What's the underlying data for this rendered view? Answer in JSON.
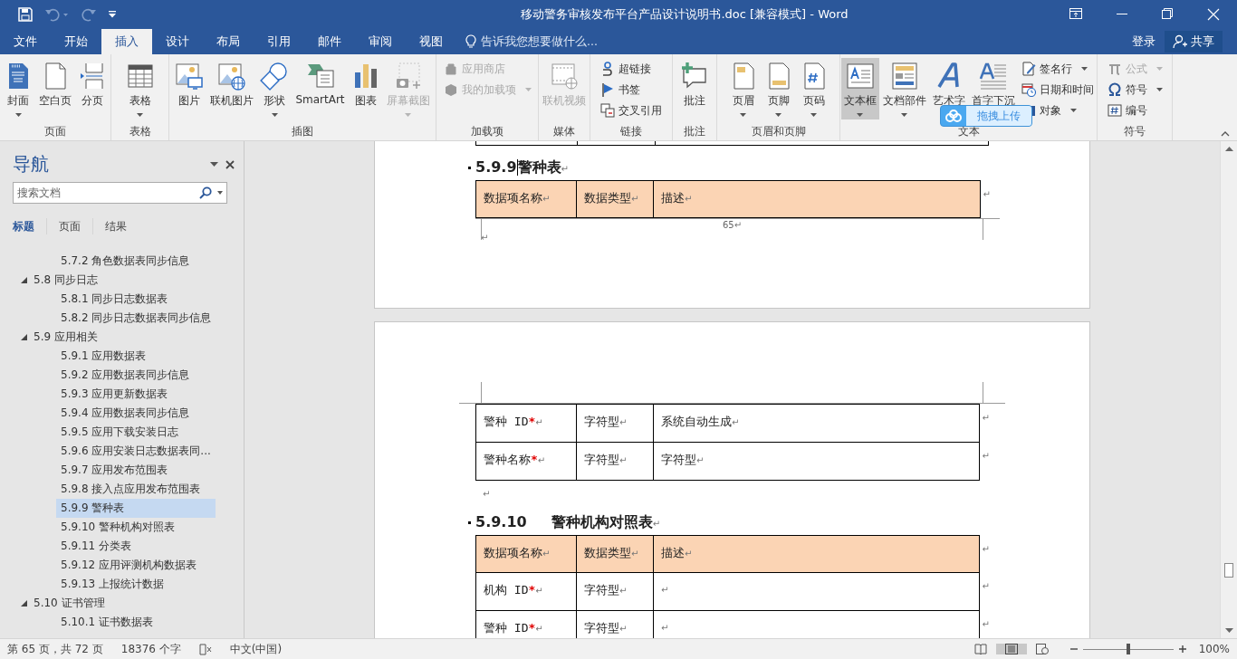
{
  "window": {
    "title": "移动警务审核发布平台产品设计说明书.doc [兼容模式] - Word"
  },
  "ribbon_tabs": [
    {
      "label": "文件",
      "selected": false
    },
    {
      "label": "开始",
      "selected": false
    },
    {
      "label": "插入",
      "selected": true
    },
    {
      "label": "设计",
      "selected": false
    },
    {
      "label": "布局",
      "selected": false
    },
    {
      "label": "引用",
      "selected": false
    },
    {
      "label": "邮件",
      "selected": false
    },
    {
      "label": "审阅",
      "selected": false
    },
    {
      "label": "视图",
      "selected": false
    }
  ],
  "tell_me": {
    "placeholder": "告诉我您想要做什么..."
  },
  "account": {
    "sign_in": "登录",
    "share": "共享"
  },
  "ribbon_groups": [
    {
      "label": "页面",
      "items": [
        {
          "kind": "large",
          "label": "封面",
          "dropdown": true,
          "disabled": false,
          "pressed": false
        },
        {
          "kind": "large",
          "label": "空白页",
          "dropdown": false,
          "disabled": false,
          "pressed": false
        },
        {
          "kind": "large",
          "label": "分页",
          "dropdown": false,
          "disabled": false,
          "pressed": false
        }
      ]
    },
    {
      "label": "表格",
      "items": [
        {
          "kind": "large",
          "label": "表格",
          "dropdown": true,
          "disabled": false,
          "pressed": false
        }
      ]
    },
    {
      "label": "插图",
      "items": [
        {
          "kind": "large",
          "label": "图片",
          "dropdown": false,
          "disabled": false,
          "pressed": false
        },
        {
          "kind": "large",
          "label": "联机图片",
          "dropdown": false,
          "disabled": false,
          "pressed": false
        },
        {
          "kind": "large",
          "label": "形状",
          "dropdown": true,
          "disabled": false,
          "pressed": false
        },
        {
          "kind": "large",
          "label": "SmartArt",
          "dropdown": false,
          "disabled": false,
          "pressed": false
        },
        {
          "kind": "large",
          "label": "图表",
          "dropdown": false,
          "disabled": false,
          "pressed": false
        },
        {
          "kind": "large",
          "label": "屏幕截图",
          "dropdown": true,
          "disabled": true,
          "pressed": false
        }
      ]
    },
    {
      "label": "加载项",
      "items": [
        {
          "kind": "stack",
          "items": [
            {
              "label": "应用商店",
              "dropdown": false,
              "disabled": true
            },
            {
              "label": "我的加载项",
              "dropdown": true,
              "disabled": true
            }
          ]
        }
      ]
    },
    {
      "label": "媒体",
      "items": [
        {
          "kind": "large",
          "label": "联机视频",
          "dropdown": false,
          "disabled": true,
          "pressed": false
        }
      ]
    },
    {
      "label": "链接",
      "items": [
        {
          "kind": "stack",
          "items": [
            {
              "label": "超链接",
              "dropdown": false,
              "disabled": false
            },
            {
              "label": "书签",
              "dropdown": false,
              "disabled": false
            },
            {
              "label": "交叉引用",
              "dropdown": false,
              "disabled": false
            }
          ]
        }
      ]
    },
    {
      "label": "批注",
      "items": [
        {
          "kind": "large",
          "label": "批注",
          "dropdown": false,
          "disabled": false,
          "pressed": false
        }
      ]
    },
    {
      "label": "页眉和页脚",
      "items": [
        {
          "kind": "large",
          "label": "页眉",
          "dropdown": true,
          "disabled": false,
          "pressed": false
        },
        {
          "kind": "large",
          "label": "页脚",
          "dropdown": true,
          "disabled": false,
          "pressed": false
        },
        {
          "kind": "large",
          "label": "页码",
          "dropdown": true,
          "disabled": false,
          "pressed": false
        }
      ]
    },
    {
      "label": "文本",
      "items": [
        {
          "kind": "large",
          "label": "文本框",
          "dropdown": true,
          "disabled": false,
          "pressed": true
        },
        {
          "kind": "large",
          "label": "文档部件",
          "dropdown": true,
          "disabled": false,
          "pressed": false
        },
        {
          "kind": "large",
          "label": "艺术字",
          "dropdown": false,
          "disabled": false,
          "pressed": false
        },
        {
          "kind": "large",
          "label": "首字下沉",
          "dropdown": false,
          "disabled": false,
          "pressed": false
        },
        {
          "kind": "stack",
          "items": [
            {
              "label": "签名行",
              "dropdown": true,
              "disabled": false
            },
            {
              "label": "日期和时间",
              "dropdown": false,
              "disabled": false
            },
            {
              "label": "对象",
              "dropdown": true,
              "disabled": false
            }
          ]
        }
      ]
    },
    {
      "label": "符号",
      "items": [
        {
          "kind": "stack",
          "items": [
            {
              "label": "公式",
              "dropdown": true,
              "disabled": true
            },
            {
              "label": "符号",
              "dropdown": true,
              "disabled": false
            },
            {
              "label": "编号",
              "dropdown": false,
              "disabled": false
            }
          ]
        }
      ]
    }
  ],
  "upload_widget": {
    "label": "拖拽上传"
  },
  "navigation": {
    "title": "导航",
    "search": {
      "placeholder": "搜索文档"
    },
    "tabs": [
      {
        "label": "标题",
        "selected": true
      },
      {
        "label": "页面",
        "selected": false
      },
      {
        "label": "结果",
        "selected": false
      }
    ],
    "headings": [
      {
        "children": [
          {
            "label": "5.7.2 角色数据表同步信息",
            "selected": false
          }
        ]
      },
      {
        "label": "5.8 同步日志",
        "selected": false,
        "expanded": true,
        "children": [
          {
            "label": "5.8.1 同步日志数据表",
            "selected": false
          },
          {
            "label": "5.8.2 同步日志数据表同步信息",
            "selected": false
          }
        ]
      },
      {
        "label": "5.9 应用相关",
        "selected": false,
        "expanded": true,
        "children": [
          {
            "label": "5.9.1 应用数据表",
            "selected": false
          },
          {
            "label": "5.9.2 应用数据表同步信息",
            "selected": false
          },
          {
            "label": "5.9.3 应用更新数据表",
            "selected": false
          },
          {
            "label": "5.9.4 应用数据表同步信息",
            "selected": false
          },
          {
            "label": "5.9.5 应用下载安装日志",
            "selected": false
          },
          {
            "label": "5.9.6 应用安装日志数据表同...",
            "selected": false
          },
          {
            "label": "5.9.7 应用发布范围表",
            "selected": false
          },
          {
            "label": "5.9.8 接入点应用发布范围表",
            "selected": false
          },
          {
            "label": "5.9.9 警种表",
            "selected": true
          },
          {
            "label": "5.9.10 警种机构对照表",
            "selected": false
          },
          {
            "label": "5.9.11 分类表",
            "selected": false
          },
          {
            "label": "5.9.12 应用评测机构数据表",
            "selected": false
          },
          {
            "label": "5.9.13 上报统计数据",
            "selected": false
          }
        ]
      },
      {
        "label": "5.10 证书管理",
        "selected": false,
        "expanded": true,
        "children": [
          {
            "label": "5.10.1 证书数据表",
            "selected": false
          }
        ]
      }
    ]
  },
  "document": {
    "pages": [
      {
        "blocks": [
          {
            "kind": "table_end"
          },
          {
            "kind": "heading",
            "number": "5.9.9",
            "title": "警种表",
            "end": "↵",
            "caret": true
          },
          {
            "kind": "table",
            "rows": [
              {
                "header": true,
                "end": "↵",
                "cells": [
                  {
                    "text": "数据项名称",
                    "end": "↵"
                  },
                  {
                    "text": "数据类型",
                    "end": "↵"
                  },
                  {
                    "text": "描述",
                    "end": "↵"
                  }
                ]
              }
            ]
          },
          {
            "kind": "footer",
            "page_number": "65",
            "end": "↵",
            "mark": "↵"
          }
        ]
      },
      {
        "blocks": [
          {
            "kind": "header_margin"
          },
          {
            "kind": "table",
            "rows": [
              {
                "header": false,
                "end": "↵",
                "cells": [
                  {
                    "text": "警种 ID",
                    "star": "*",
                    "end": "↵"
                  },
                  {
                    "text": "字符型",
                    "end": "↵"
                  },
                  {
                    "text": "系统自动生成",
                    "end": "↵"
                  }
                ]
              },
              {
                "header": false,
                "end": "↵",
                "cells": [
                  {
                    "text": "警种名称",
                    "star": "*",
                    "end": "↵"
                  },
                  {
                    "text": "字符型",
                    "end": "↵"
                  },
                  {
                    "text": "字符型",
                    "end": "↵"
                  }
                ]
              }
            ]
          },
          {
            "kind": "paragraph",
            "end": "↵"
          },
          {
            "kind": "heading",
            "number": "5.9.10",
            "title": "警种机构对照表",
            "end": "↵",
            "caret": false
          },
          {
            "kind": "table",
            "rows": [
              {
                "header": true,
                "end": "↵",
                "cells": [
                  {
                    "text": "数据项名称",
                    "end": "↵"
                  },
                  {
                    "text": "数据类型",
                    "end": "↵"
                  },
                  {
                    "text": "描述",
                    "end": "↵"
                  }
                ]
              },
              {
                "header": false,
                "end": "↵",
                "cells": [
                  {
                    "text": "机构 ID",
                    "star": "*",
                    "end": "↵"
                  },
                  {
                    "text": "字符型",
                    "end": "↵"
                  },
                  {
                    "end": "↵"
                  }
                ]
              },
              {
                "header": false,
                "end": "↵",
                "cells": [
                  {
                    "text": "警种 ID",
                    "star": "*",
                    "end": "↵"
                  },
                  {
                    "text": "字符型",
                    "end": "↵"
                  },
                  {
                    "end": "↵"
                  }
                ]
              }
            ]
          }
        ]
      }
    ]
  },
  "status_bar": {
    "page": "第 65 页，共 72 页",
    "words": "18376 个字",
    "language": "中文(中国)",
    "zoom": {
      "level": 0.5,
      "reading": "100%"
    }
  }
}
